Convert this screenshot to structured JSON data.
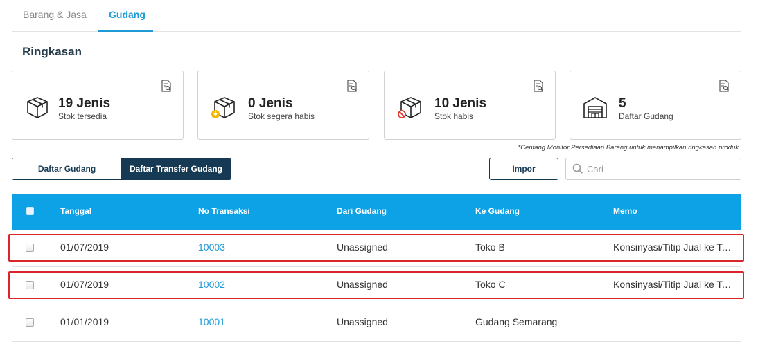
{
  "tabs": [
    {
      "label": "Barang & Jasa"
    },
    {
      "label": "Gudang"
    }
  ],
  "summary": {
    "title": "Ringkasan",
    "cards": [
      {
        "value": "19",
        "unit": "Jenis",
        "label": "Stok tersedia",
        "icon": "box-icon"
      },
      {
        "value": "0",
        "unit": "Jenis",
        "label": "Stok segera habis",
        "icon": "box-warning-icon"
      },
      {
        "value": "10",
        "unit": "Jenis",
        "label": "Stok habis",
        "icon": "box-empty-icon"
      },
      {
        "value": "5",
        "unit": "",
        "label": "Daftar Gudang",
        "icon": "warehouse-icon"
      }
    ],
    "note": "*Centang Monitor Persediaan Barang untuk menampilkan ringkasan produk"
  },
  "toggle": {
    "daftar_gudang": "Daftar Gudang",
    "daftar_transfer": "Daftar Transfer Gudang"
  },
  "actions": {
    "impor": "Impor",
    "search_placeholder": "Cari"
  },
  "table": {
    "columns": [
      "Tanggal",
      "No Transaksi",
      "Dari Gudang",
      "Ke Gudang",
      "Memo"
    ],
    "rows": [
      {
        "tanggal": "01/07/2019",
        "no": "10003",
        "dari": "Unassigned",
        "ke": "Toko B",
        "memo": "Konsinyasi/Titip Jual ke Toko B"
      },
      {
        "tanggal": "01/07/2019",
        "no": "10002",
        "dari": "Unassigned",
        "ke": "Toko C",
        "memo": "Konsinyasi/Titip Jual ke Toko C"
      },
      {
        "tanggal": "01/01/2019",
        "no": "10001",
        "dari": "Unassigned",
        "ke": "Gudang Semarang",
        "memo": ""
      }
    ]
  },
  "colors": {
    "accent": "#1e9bd7",
    "header_bg": "#0da1e5",
    "navy": "#173a54",
    "highlight": "#d9262c",
    "warning": "#f5b800",
    "danger": "#e0342b"
  }
}
